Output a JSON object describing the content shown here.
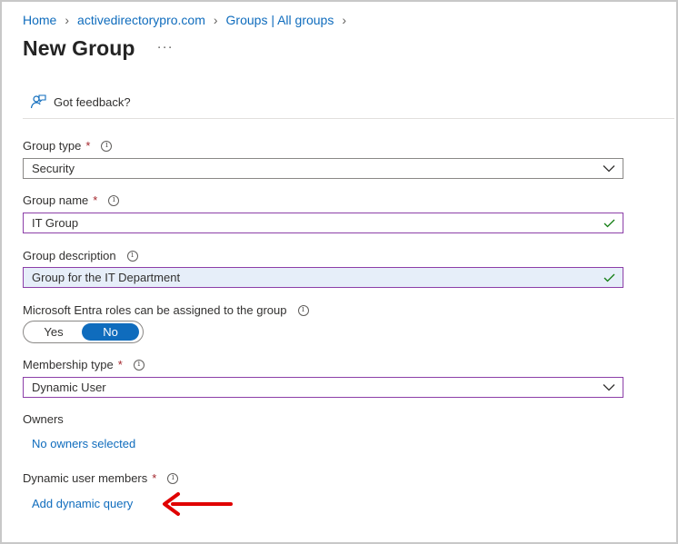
{
  "breadcrumb": [
    "Home",
    "activedirectorypro.com",
    "Groups | All groups"
  ],
  "page": {
    "title": "New Group",
    "more": "···"
  },
  "feedback": {
    "label": "Got feedback?",
    "icon": "feedback-person-icon"
  },
  "form": {
    "group_type": {
      "label": "Group type",
      "required": "*",
      "value": "Security"
    },
    "group_name": {
      "label": "Group name",
      "required": "*",
      "value": "IT Group"
    },
    "group_description": {
      "label": "Group description",
      "value": "Group for the IT Department"
    },
    "entra_roles": {
      "label": "Microsoft Entra roles can be assigned to the group",
      "yes": "Yes",
      "no": "No",
      "selected": "No"
    },
    "membership_type": {
      "label": "Membership type",
      "required": "*",
      "value": "Dynamic User"
    },
    "owners": {
      "label": "Owners",
      "link": "No owners selected"
    },
    "dynamic_members": {
      "label": "Dynamic user members",
      "required": "*",
      "link": "Add dynamic query"
    }
  },
  "colors": {
    "accent": "#0f6cbd",
    "required": "#a4262c",
    "focus_border": "#8c3fa8",
    "valid_check": "#107c10",
    "annotation_arrow": "#e00000"
  },
  "info_glyph": "i"
}
